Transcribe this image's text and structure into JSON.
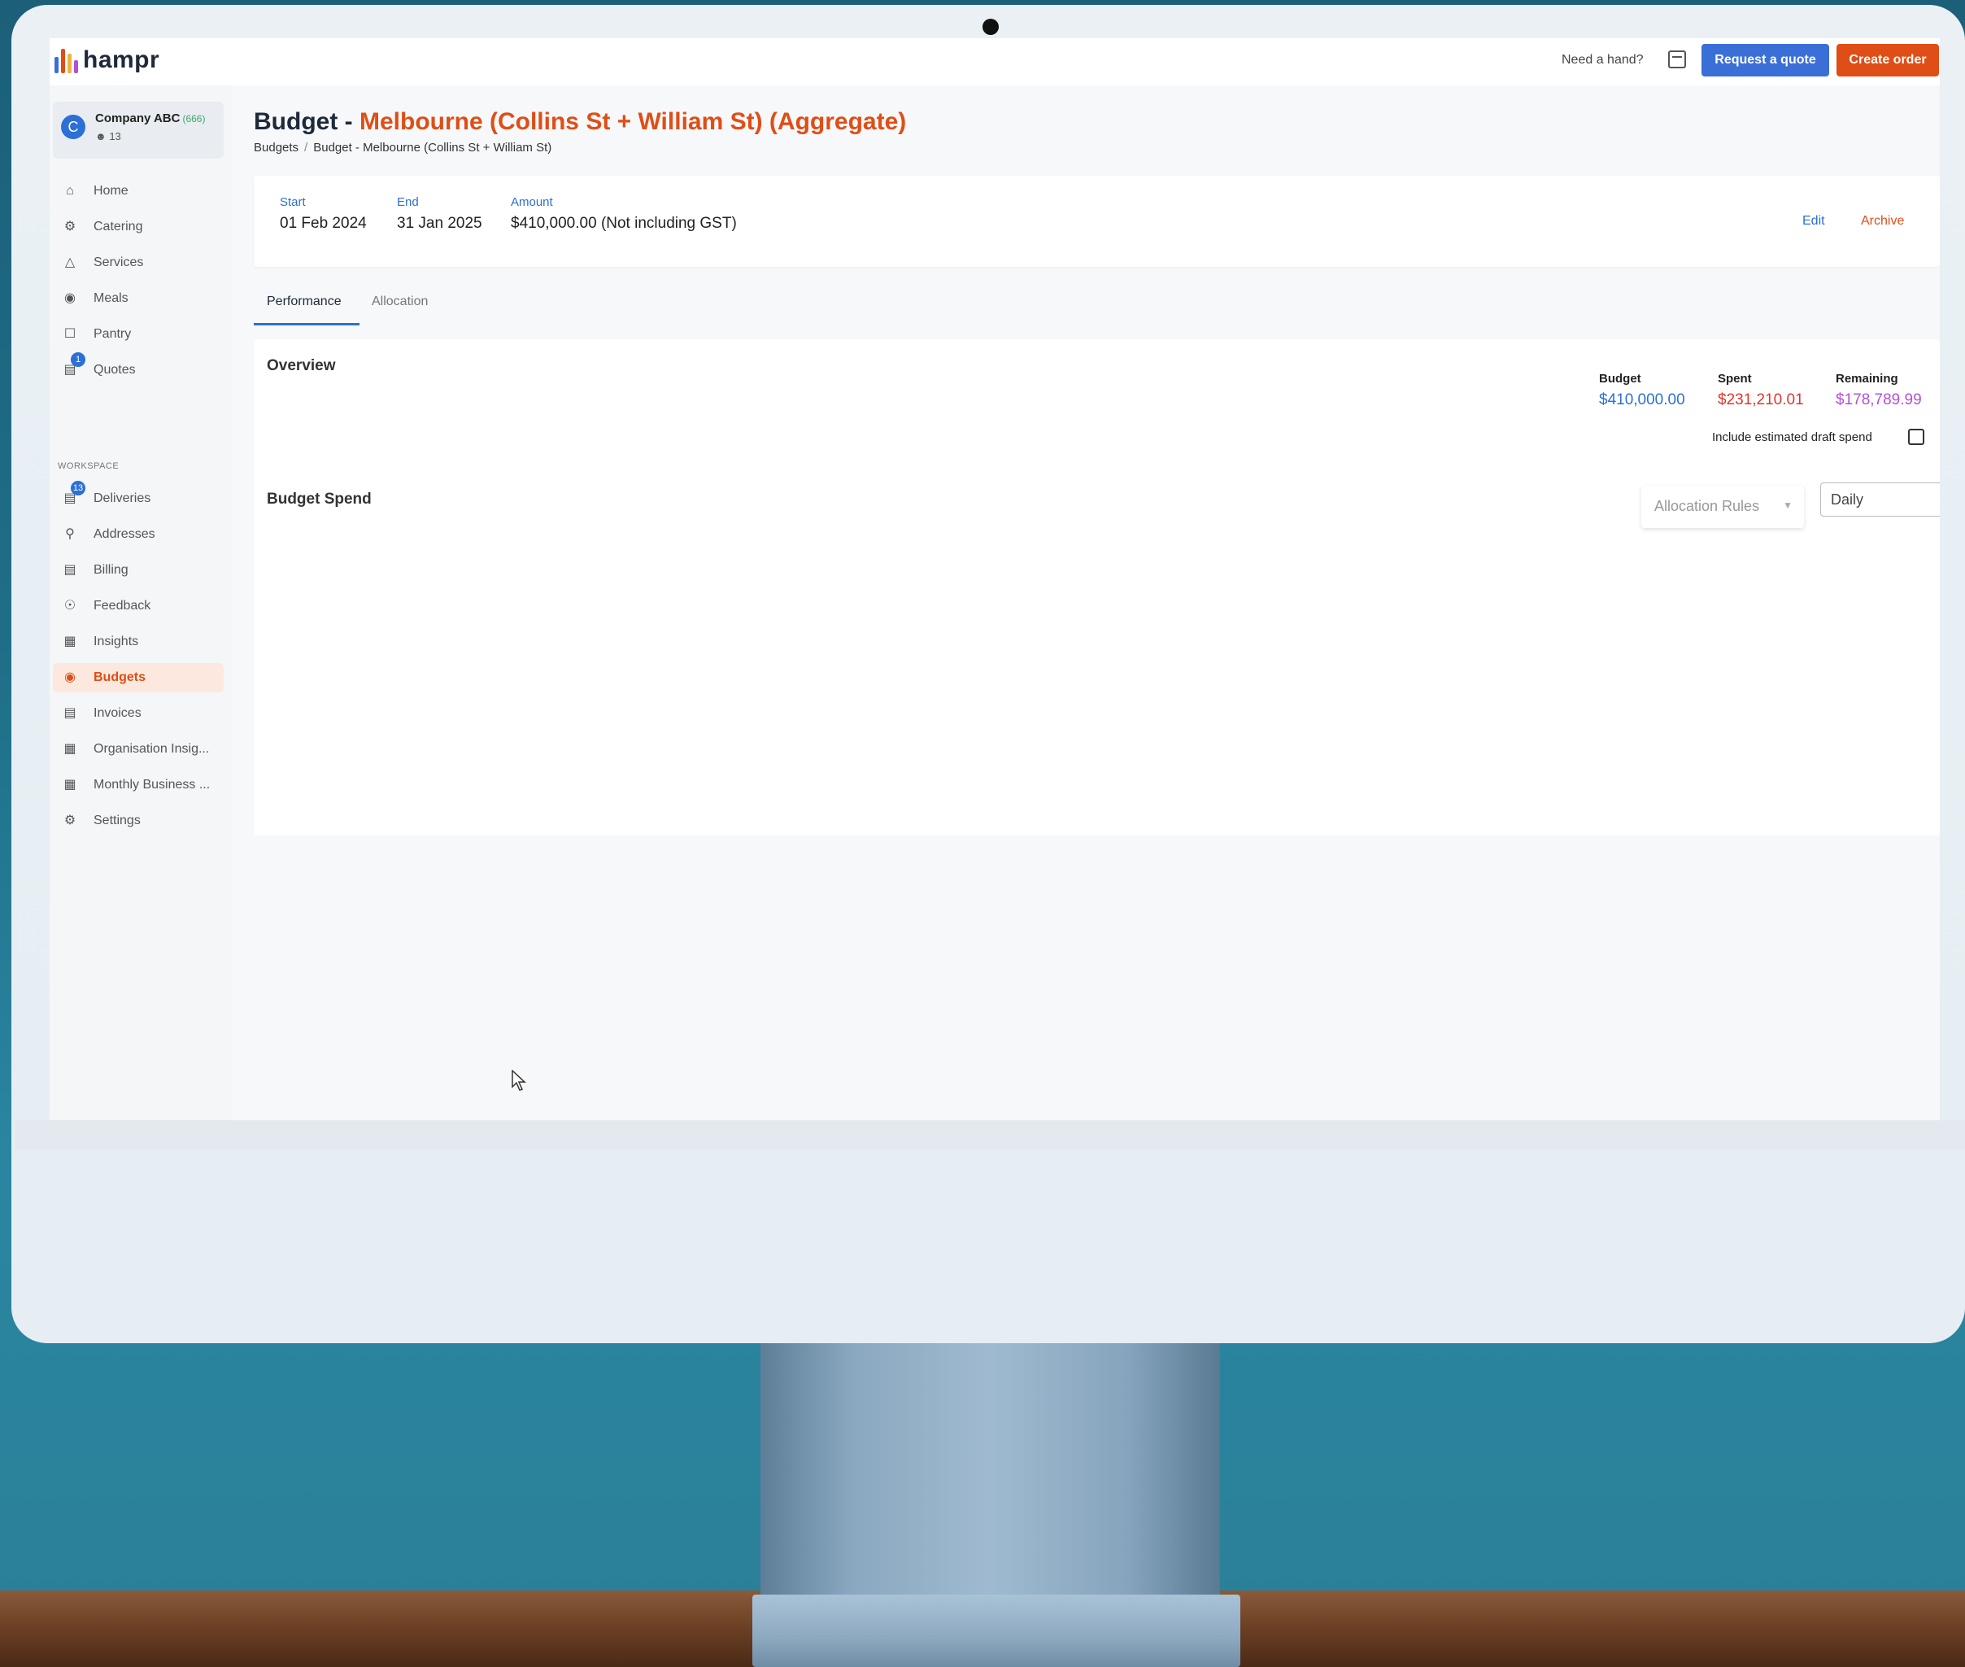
{
  "header": {
    "logo_text": "hampr",
    "need_hand": "Need a hand?",
    "calendar_icon": "calendar-icon",
    "request_quote": "Request a quote",
    "create_order": "Create order",
    "colors": {
      "primary": "#3b6fd8",
      "accent": "#df4e16"
    }
  },
  "company": {
    "avatar_letter": "C",
    "name": "Company ABC",
    "code": "(666)",
    "users": "13"
  },
  "sidebar": {
    "items": [
      {
        "label": "Home",
        "icon": "home-icon"
      },
      {
        "label": "Catering",
        "icon": "utensils-icon"
      },
      {
        "label": "Services",
        "icon": "services-icon"
      },
      {
        "label": "Meals",
        "icon": "meals-icon"
      },
      {
        "label": "Pantry",
        "icon": "pantry-icon"
      },
      {
        "label": "Quotes",
        "icon": "quotes-icon",
        "badge": "1"
      }
    ],
    "workspace_label": "WORKSPACE",
    "workspace_items": [
      {
        "label": "Deliveries",
        "icon": "deliveries-icon",
        "badge": "13"
      },
      {
        "label": "Addresses",
        "icon": "location-pin-icon"
      },
      {
        "label": "Billing",
        "icon": "billing-icon"
      },
      {
        "label": "Feedback",
        "icon": "feedback-icon"
      },
      {
        "label": "Insights",
        "icon": "bar-chart-icon"
      },
      {
        "label": "Budgets",
        "icon": "money-bag-icon",
        "active": true
      },
      {
        "label": "Invoices",
        "icon": "invoice-icon"
      },
      {
        "label": "Organisation Insig...",
        "icon": "bar-chart-icon"
      },
      {
        "label": "Monthly Business ...",
        "icon": "bar-chart-icon"
      },
      {
        "label": "Settings",
        "icon": "gear-icon"
      }
    ]
  },
  "page": {
    "title_prefix": "Budget - ",
    "title_accent": "Melbourne (Collins St + William St) (Aggregate)",
    "breadcrumb_root": "Budgets",
    "breadcrumb_sep": "/",
    "breadcrumb_current": "Budget - Melbourne (Collins St + William St)"
  },
  "info": {
    "start_label": "Start",
    "start_value": "01 Feb 2024",
    "end_label": "End",
    "end_value": "31 Jan 2025",
    "amount_label": "Amount",
    "amount_value": "$410,000.00 (Not including GST)",
    "edit": "Edit",
    "archive": "Archive"
  },
  "tabs": [
    {
      "label": "Performance",
      "active": true
    },
    {
      "label": "Allocation",
      "active": false
    }
  ],
  "overview": {
    "title": "Overview",
    "budget_label": "Budget",
    "budget_value": "$410,000.00",
    "spent_label": "Spent",
    "spent_value": "$231,210.01",
    "remaining_label": "Remaining",
    "remaining_value": "$178,789.99",
    "draft_label": "Include estimated draft spend",
    "draft_checked": false,
    "colors": {
      "budget": "#2c6fd6",
      "spent": "#e0362c",
      "remaining": "#b44fd8"
    }
  },
  "budget_spend": {
    "title": "Budget Spend",
    "allocation_placeholder": "Allocation Rules",
    "period_value": "Daily"
  }
}
